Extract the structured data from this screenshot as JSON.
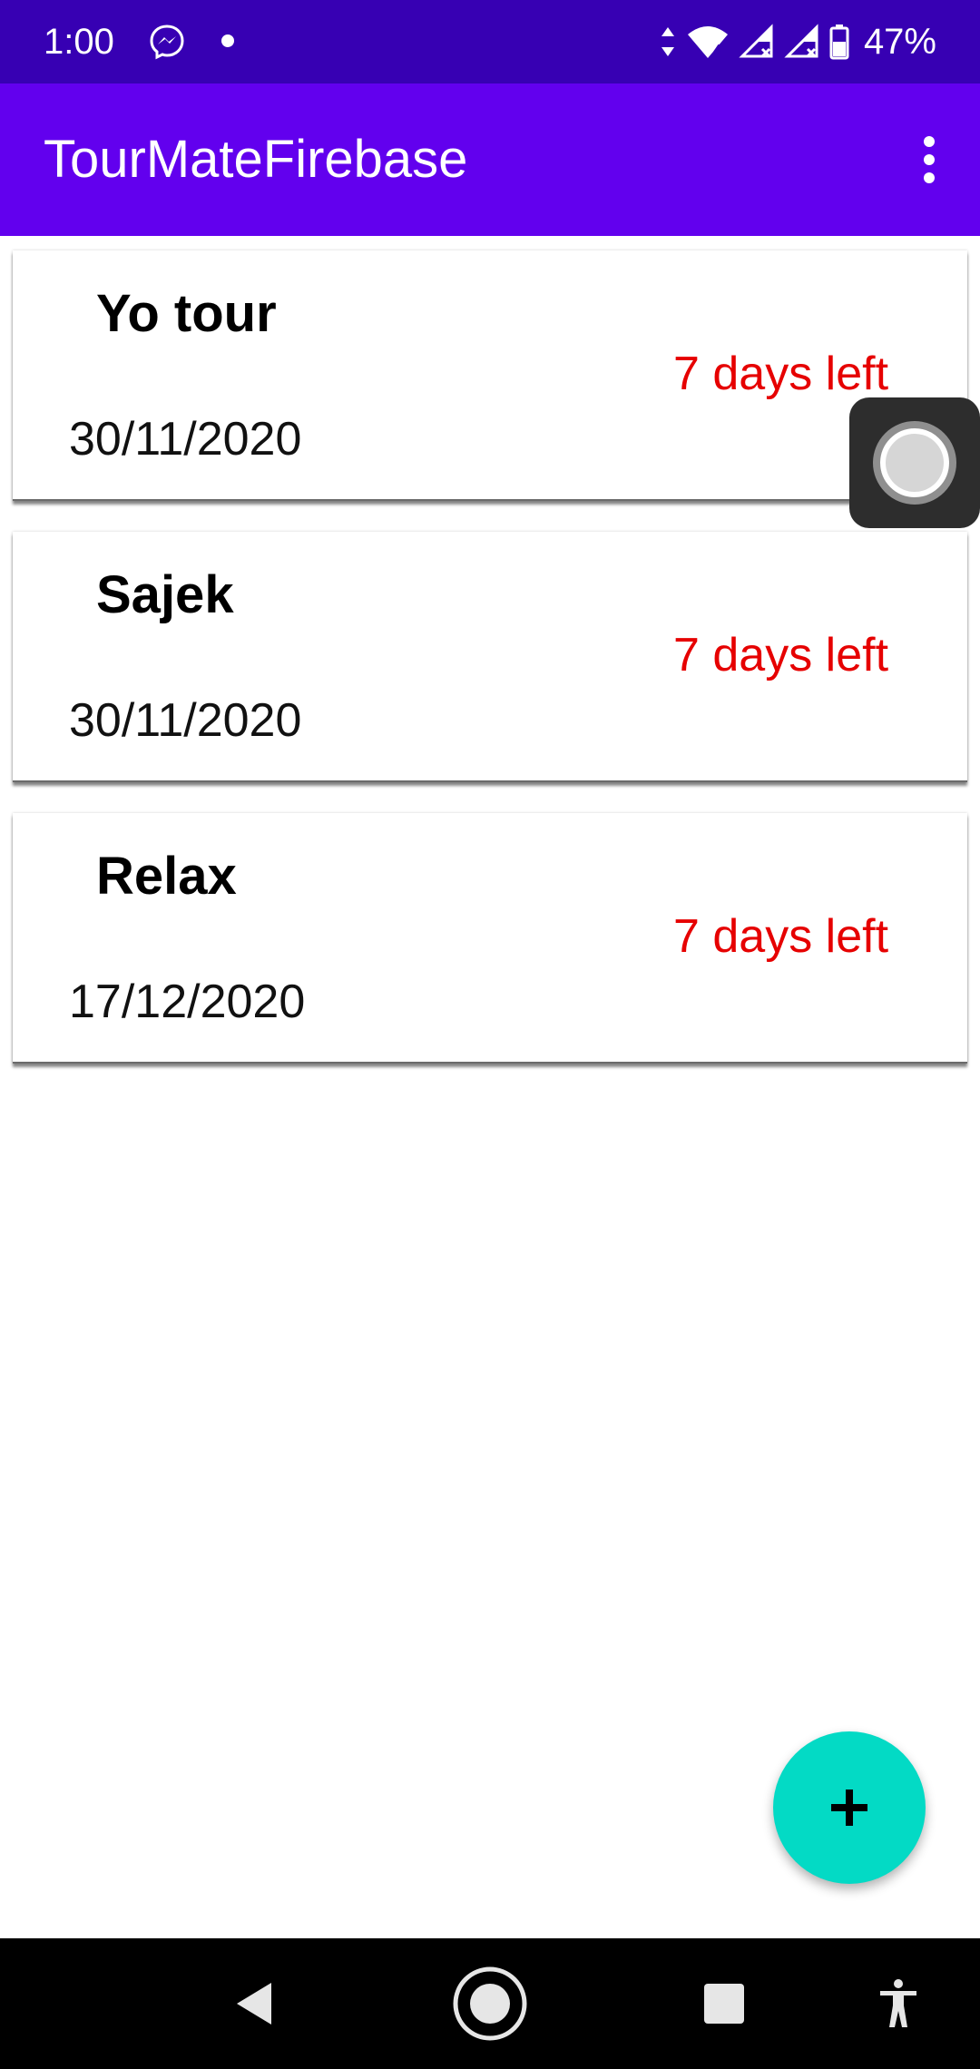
{
  "status_bar": {
    "time": "1:00",
    "battery_text": "47%",
    "icons": [
      "messenger-icon",
      "notification-dot-icon",
      "data-arrows-icon",
      "wifi-icon",
      "signal-icon",
      "signal-icon",
      "battery-icon"
    ]
  },
  "app_bar": {
    "title": "TourMateFirebase",
    "menu_icon": "overflow-menu-icon"
  },
  "tours": [
    {
      "name": "Yo tour",
      "days_left": "7 days left",
      "date": "30/11/2020"
    },
    {
      "name": "Sajek",
      "days_left": "7 days left",
      "date": "30/11/2020"
    },
    {
      "name": "Relax",
      "days_left": "7 days left",
      "date": "17/12/2020"
    }
  ],
  "fab": {
    "icon": "plus-icon"
  },
  "nav_bar": {
    "icons": [
      "back-icon",
      "home-icon",
      "recents-icon",
      "accessibility-icon"
    ]
  },
  "colors": {
    "status_bar": "#3700b3",
    "app_bar": "#6200ee",
    "days_left_text": "#e60000",
    "fab": "#03dac5"
  }
}
